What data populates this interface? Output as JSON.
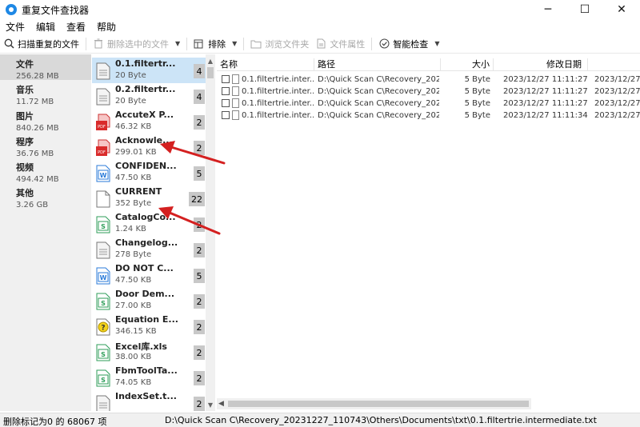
{
  "window": {
    "title": "重复文件查找器",
    "min": "─",
    "max": "☐",
    "close": "✕"
  },
  "menu": [
    "文件",
    "编辑",
    "查看",
    "帮助"
  ],
  "toolbar": {
    "scan": "扫描重复的文件",
    "delete_selected": "删除选中的文件",
    "sort": "排除",
    "browse_folder": "浏览文件夹",
    "file_props": "文件属性",
    "smart_check": "智能检查"
  },
  "categories": [
    {
      "name": "文件",
      "size": "256.28 MB"
    },
    {
      "name": "音乐",
      "size": "11.72 MB"
    },
    {
      "name": "图片",
      "size": "840.26 MB"
    },
    {
      "name": "程序",
      "size": "36.76 MB"
    },
    {
      "name": "视频",
      "size": "494.42 MB"
    },
    {
      "name": "其他",
      "size": "3.26 GB"
    }
  ],
  "files": [
    {
      "name": "0.1.filtertr...",
      "size": "20 Byte",
      "count": "4",
      "icon": "text-file-icon"
    },
    {
      "name": "0.2.filtertr...",
      "size": "20 Byte",
      "count": "4",
      "icon": "text-file-icon"
    },
    {
      "name": "AccuteX P...",
      "size": "46.32 KB",
      "count": "2",
      "icon": "pdf-file-icon"
    },
    {
      "name": "Acknowle...",
      "size": "299.01 KB",
      "count": "2",
      "icon": "pdf-file-icon"
    },
    {
      "name": "CONFIDEN...",
      "size": "47.50 KB",
      "count": "5",
      "icon": "word-file-icon"
    },
    {
      "name": "CURRENT",
      "size": "352 Byte",
      "count": "22",
      "icon": "blank-file-icon"
    },
    {
      "name": "CatalogCo...",
      "size": "1.24 KB",
      "count": "2",
      "icon": "sheet-file-icon"
    },
    {
      "name": "Changelog...",
      "size": "278 Byte",
      "count": "2",
      "icon": "text-file-icon"
    },
    {
      "name": "DO NOT C...",
      "size": "47.50 KB",
      "count": "5",
      "icon": "word-file-icon"
    },
    {
      "name": "Door Dem...",
      "size": "27.00 KB",
      "count": "2",
      "icon": "sheet-file-icon"
    },
    {
      "name": "Equation E...",
      "size": "346.15 KB",
      "count": "2",
      "icon": "unknown-file-icon"
    },
    {
      "name": "Excel库.xls",
      "size": "38.00 KB",
      "count": "2",
      "icon": "sheet-file-icon"
    },
    {
      "name": "FbmToolTa...",
      "size": "74.05 KB",
      "count": "2",
      "icon": "sheet-file-icon"
    },
    {
      "name": "IndexSet.t...",
      "size": "",
      "count": "2",
      "icon": "text-file-icon"
    }
  ],
  "table": {
    "headers": [
      "名称",
      "路径",
      "大小",
      "修改日期"
    ],
    "rows": [
      {
        "name": "0.1.filtertrie.inter...",
        "path": "D:\\Quick Scan C\\Recovery_202...",
        "size": "5 Byte",
        "modified": "2023/12/27 11:11:27",
        "extra": "2023/12/27"
      },
      {
        "name": "0.1.filtertrie.inter...",
        "path": "D:\\Quick Scan C\\Recovery_202...",
        "size": "5 Byte",
        "modified": "2023/12/27 11:11:27",
        "extra": "2023/12/27"
      },
      {
        "name": "0.1.filtertrie.inter...",
        "path": "D:\\Quick Scan C\\Recovery_202...",
        "size": "5 Byte",
        "modified": "2023/12/27 11:11:27",
        "extra": "2023/12/27"
      },
      {
        "name": "0.1.filtertrie.inter...",
        "path": "D:\\Quick Scan C\\Recovery_202...",
        "size": "5 Byte",
        "modified": "2023/12/27 11:11:34",
        "extra": "2023/12/27"
      }
    ]
  },
  "status": {
    "left": "删除标记为0 的 68067 项",
    "path": "D:\\Quick Scan C\\Recovery_20231227_110743\\Others\\Documents\\txt\\0.1.filtertrie.intermediate.txt"
  },
  "colors": {
    "accent": "#1e88e5",
    "selection": "#cce4f7",
    "arrow": "#d42020"
  }
}
